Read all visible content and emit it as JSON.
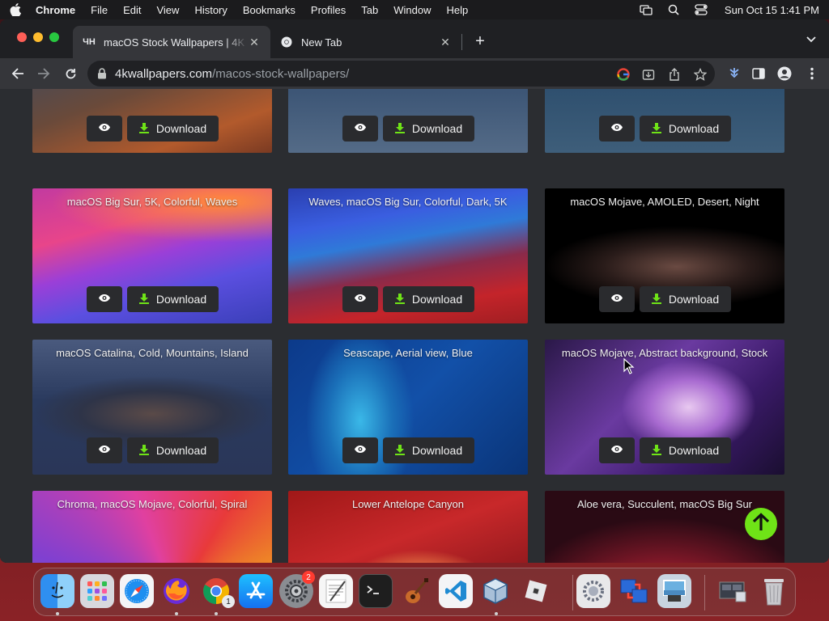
{
  "menubar": {
    "app_name": "Chrome",
    "menus": [
      "File",
      "Edit",
      "View",
      "History",
      "Bookmarks",
      "Profiles",
      "Tab",
      "Window",
      "Help"
    ],
    "clock": "Sun Oct 15  1:41 PM"
  },
  "tabs": {
    "active": {
      "favicon_text": "ЧН",
      "title": "macOS Stock Wallpapers | 4K",
      "close": "✕"
    },
    "inactive": {
      "title": "New Tab",
      "close": "✕"
    },
    "new_tab": "+"
  },
  "omnibox": {
    "host": "4kwallpapers.com",
    "path": "/macos-stock-wallpapers/"
  },
  "colors": {
    "accent_green": "#6fe317",
    "page_bg": "#2b2d31",
    "button_bg": "#2a2b2e"
  },
  "cards": {
    "view_icon": "eye-icon",
    "download_label": "Download",
    "row0": [
      {
        "caption": ""
      },
      {
        "caption": ""
      },
      {
        "caption": ""
      }
    ],
    "row1": [
      {
        "caption": "macOS Big Sur, 5K, Colorful, Waves"
      },
      {
        "caption": "Waves, macOS Big Sur, Colorful, Dark, 5K"
      },
      {
        "caption": "macOS Mojave, AMOLED, Desert, Night"
      }
    ],
    "row2": [
      {
        "caption": "macOS Catalina, Cold, Mountains, Island"
      },
      {
        "caption": "Seascape, Aerial view, Blue"
      },
      {
        "caption": "macOS Mojave, Abstract background, Stock"
      }
    ],
    "row3": [
      {
        "caption": "Chroma, macOS Mojave, Colorful, Spiral"
      },
      {
        "caption": "Lower Antelope Canyon"
      },
      {
        "caption": "Aloe vera, Succulent, macOS Big Sur"
      }
    ]
  },
  "dock": {
    "apps": [
      "finder-icon",
      "launchpad-icon",
      "safari-icon",
      "firefox-icon",
      "chrome-icon",
      "app-store-icon",
      "system-settings-icon",
      "textedit-icon",
      "terminal-icon",
      "garageband-icon",
      "vscode-icon",
      "virtualbox-icon",
      "roblox-icon",
      "utility-icon",
      "migration-icon",
      "preview-icon",
      "screenshot-icon",
      "trash-icon"
    ],
    "settings_badge": "2",
    "chrome_badge": "1"
  }
}
